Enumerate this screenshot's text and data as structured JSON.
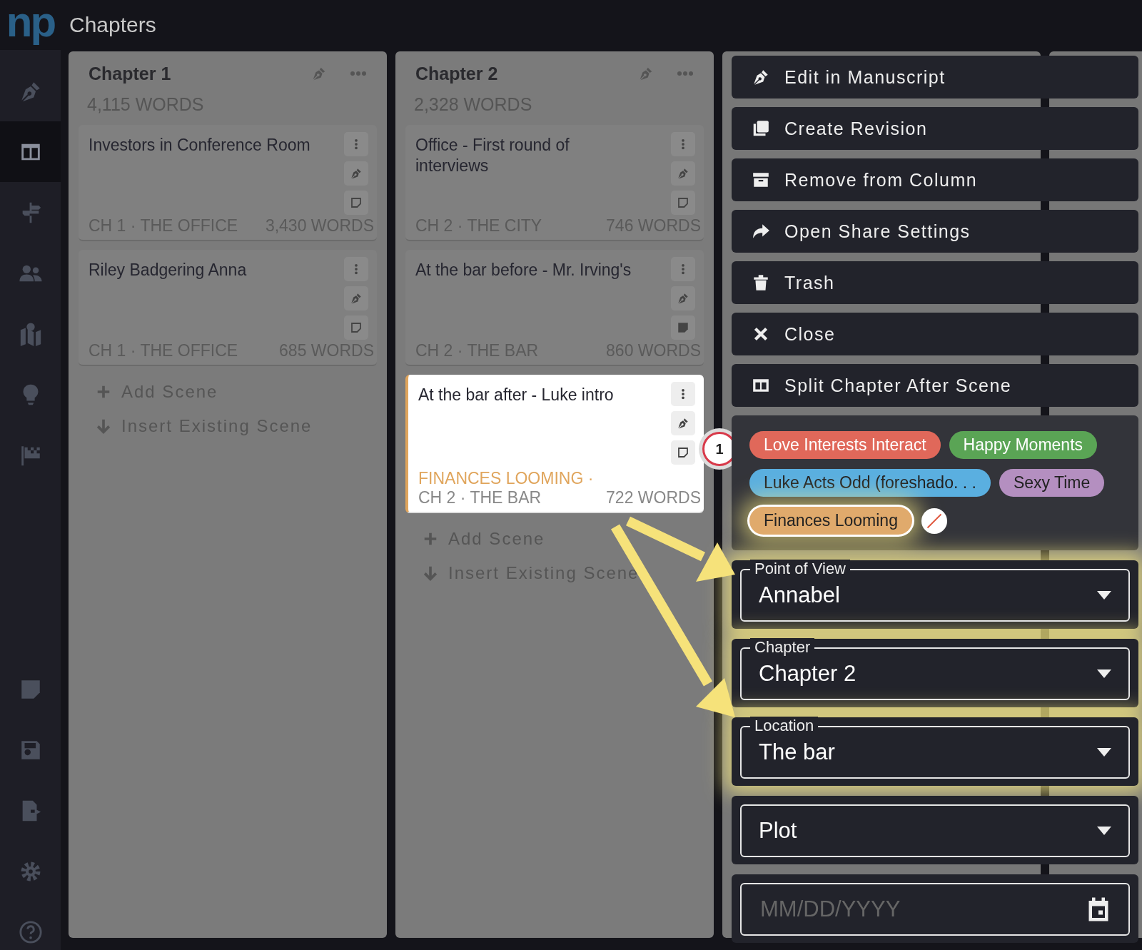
{
  "app": {
    "logo": "np",
    "title": "Chapters"
  },
  "sidebar": {
    "items": [
      {
        "selected": false
      },
      {
        "selected": true
      },
      {
        "selected": false
      },
      {
        "selected": false
      },
      {
        "selected": false
      },
      {
        "selected": false
      },
      {
        "selected": false
      }
    ]
  },
  "columns": [
    {
      "title": "Chapter 1",
      "word_count": "4,115 WORDS",
      "scenes": [
        {
          "title": "Investors in Conference Room",
          "location": "CH 1 · THE OFFICE",
          "word_count": "3,430 WORDS",
          "has_notes": false,
          "selected": false
        },
        {
          "title": "Riley Badgering Anna",
          "location": "CH 1 · THE OFFICE",
          "word_count": "685 WORDS",
          "has_notes": false,
          "selected": false
        }
      ],
      "actions": [
        "Add Scene",
        "Insert Existing Scene"
      ]
    },
    {
      "title": "Chapter 2",
      "word_count": "2,328 WORDS",
      "scenes": [
        {
          "title": "Office - First round of interviews",
          "location": "CH 2 · THE CITY",
          "word_count": "746 WORDS",
          "has_notes": false,
          "selected": false
        },
        {
          "title": "At the bar before - Mr. Irving's",
          "location": "CH 2 · THE BAR",
          "word_count": "860 WORDS",
          "has_notes": true,
          "selected": false
        },
        {
          "title": "At the bar after - Luke intro",
          "plotline": {
            "label": "FINANCES LOOMING ·",
            "color": "#e0a55c"
          },
          "location": "CH 2 · THE BAR",
          "word_count": "722 WORDS",
          "has_notes": false,
          "selected": true
        }
      ],
      "actions": [
        "Add Scene",
        "Insert Existing Scene"
      ]
    }
  ],
  "step_badge": "1",
  "menu": {
    "items": [
      {
        "label": "Edit in Manuscript"
      },
      {
        "label": "Create Revision"
      },
      {
        "label": "Remove from Column"
      },
      {
        "label": "Open Share Settings"
      },
      {
        "label": "Trash"
      },
      {
        "label": "Close"
      },
      {
        "label": "Split Chapter After Scene"
      }
    ]
  },
  "tags": [
    {
      "label": "Love Interests Interact",
      "color": "#e0685a",
      "selected": false
    },
    {
      "label": "Happy Moments",
      "color": "#5aa455",
      "selected": false
    },
    {
      "label": "Luke Acts Odd (foreshado. . .",
      "color": "#5aafe0",
      "selected": false
    },
    {
      "label": "Sexy Time",
      "color": "#b48fc0",
      "selected": false
    },
    {
      "label": "Finances Looming",
      "color": "#e0aa6c",
      "selected": true
    }
  ],
  "fields": [
    {
      "kind": "select",
      "label": "Point of View",
      "value": "Annabel",
      "highlighted": true
    },
    {
      "kind": "select",
      "label": "Chapter",
      "value": "Chapter 2",
      "highlighted": true
    },
    {
      "kind": "select",
      "label": "Location",
      "value": "The bar",
      "highlighted": true
    },
    {
      "kind": "select",
      "value": "Plot",
      "highlighted": false
    },
    {
      "kind": "date",
      "placeholder": "MM/DD/YYYY",
      "highlighted": false
    }
  ]
}
